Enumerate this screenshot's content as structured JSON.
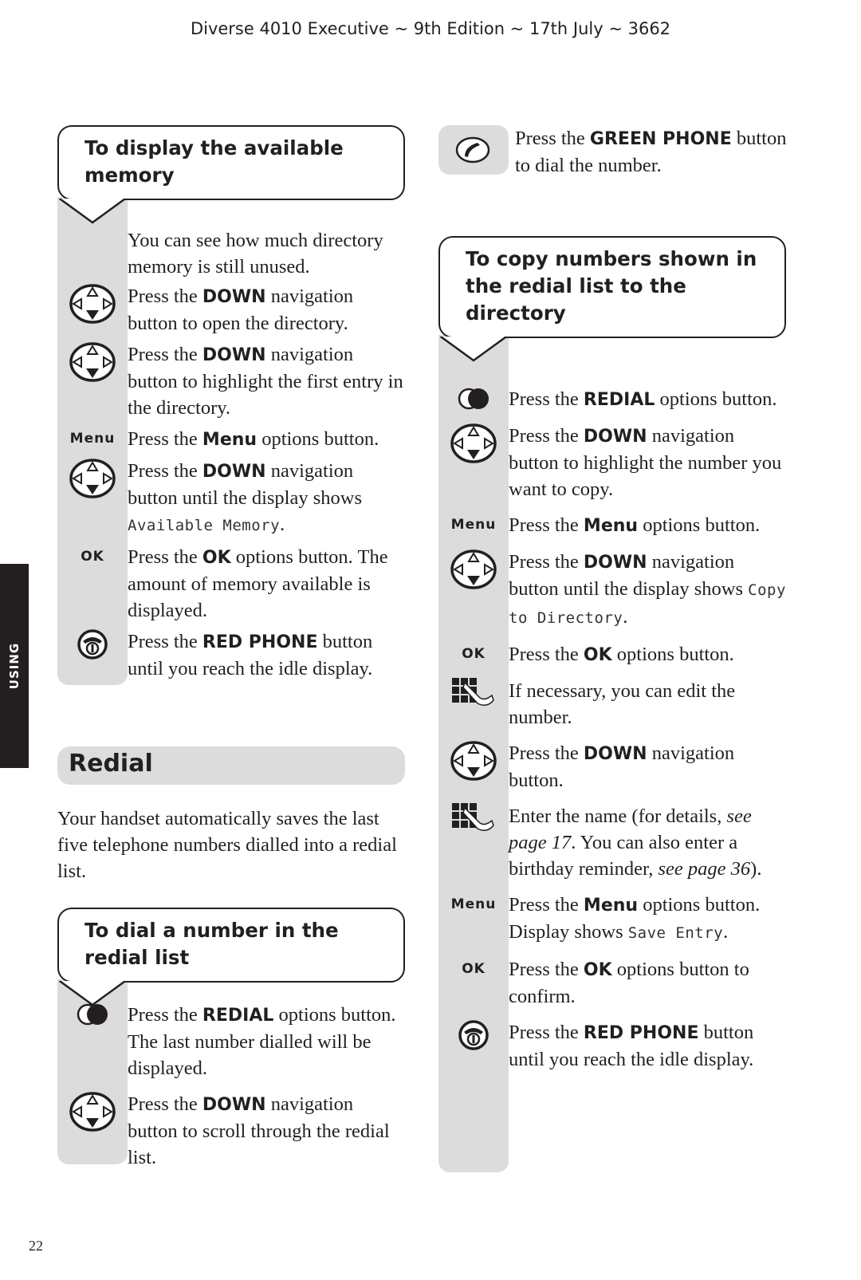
{
  "header": {
    "title": "Diverse 4010 Executive ~ 9th Edition ~ 17th July ~ 3662"
  },
  "side_tab": {
    "label": "USING"
  },
  "page_number": "22",
  "left": {
    "memory_section": {
      "title_line1": "To display the available",
      "title_line2": "memory",
      "intro": "You can see how much directory memory is still unused.",
      "steps": [
        {
          "icon": "navigation-down-icon",
          "pre": "Press the ",
          "bold": "DOWN",
          "post": " navigation button to open the directory."
        },
        {
          "icon": "navigation-down-icon",
          "pre": "Press the ",
          "bold": "DOWN",
          "post": " navigation button to highlight the first entry in the directory."
        },
        {
          "icon_label": "Menu",
          "pre": "Press the ",
          "bold": "Menu",
          "post": " options button."
        },
        {
          "icon": "navigation-down-icon",
          "pre": "Press the ",
          "bold": "DOWN",
          "post": " navigation button until the display shows ",
          "lcd": "Available Memory",
          "tail": "."
        },
        {
          "icon_label": "OK",
          "pre": "Press the ",
          "bold": "OK",
          "post": " options button. The amount of memory available is displayed."
        },
        {
          "icon": "red-phone-icon",
          "pre": "Press the ",
          "bold": "RED PHONE",
          "post": " button until you reach the idle display."
        }
      ]
    },
    "redial_section": {
      "heading": "Redial",
      "intro": "Your handset automatically saves the last five telephone numbers dialled into a redial list."
    },
    "dial_section": {
      "title_line1": "To dial a number in the",
      "title_line2": "redial list",
      "steps": [
        {
          "icon": "redial-icon",
          "pre": "Press the ",
          "bold": "REDIAL",
          "post": " options button. The last number dialled will be displayed."
        },
        {
          "icon": "navigation-down-icon",
          "pre": "Press the ",
          "bold": "DOWN",
          "post": " navigation button to scroll through the redial list."
        }
      ]
    }
  },
  "right": {
    "green_step": {
      "icon": "green-phone-icon",
      "pre": "Press the ",
      "bold": "GREEN PHONE",
      "post": " button to dial the number."
    },
    "copy_section": {
      "title_line1": "To copy numbers shown in",
      "title_line2": "the redial list to the directory",
      "steps": [
        {
          "icon": "redial-icon",
          "pre": "Press the ",
          "bold": "REDIAL",
          "post": " options button."
        },
        {
          "icon": "navigation-down-icon",
          "pre": "Press the ",
          "bold": "DOWN",
          "post": " navigation button to highlight the number you want to copy."
        },
        {
          "icon_label": "Menu",
          "pre": "Press the ",
          "bold": "Menu",
          "post": " options button."
        },
        {
          "icon": "navigation-down-icon",
          "pre": "Press the ",
          "bold": "DOWN",
          "post": " navigation button until the display shows ",
          "lcd": "Copy to Directory",
          "tail": "."
        },
        {
          "icon_label": "OK",
          "pre": "Press the ",
          "bold": "OK",
          "post": " options button."
        },
        {
          "icon": "keypad-icon",
          "text": "If necessary, you can edit the number."
        },
        {
          "icon": "navigation-down-icon",
          "pre": "Press the ",
          "bold": "DOWN",
          "post": " navigation button."
        },
        {
          "icon": "keypad-icon",
          "text1": "Enter the name (for details, ",
          "ref1": "see page 17",
          "text2": ". You can also enter a birthday reminder, ",
          "ref2": "see page 36",
          "text3": ")."
        },
        {
          "icon_label": "Menu",
          "pre": "Press the ",
          "bold": "Menu",
          "post": " options button. Display shows ",
          "lcd": "Save Entry",
          "tail": "."
        },
        {
          "icon_label": "OK",
          "pre": "Press the ",
          "bold": "OK",
          "post": " options button to confirm."
        },
        {
          "icon": "red-phone-icon",
          "pre": "Press the ",
          "bold": "RED PHONE",
          "post": " button until you reach the idle display."
        }
      ]
    }
  }
}
